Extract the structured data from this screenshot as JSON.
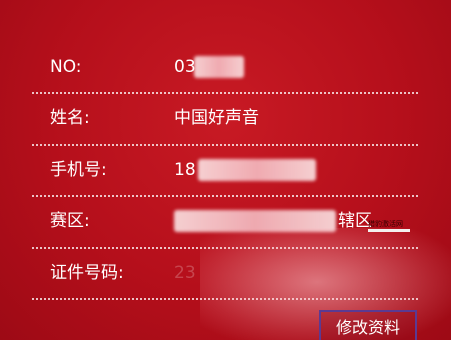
{
  "profile": {
    "fields": [
      {
        "label": "NO:",
        "value": "03"
      },
      {
        "label": "姓名:",
        "value": "中国好声音"
      },
      {
        "label": "手机号:",
        "value": "18"
      },
      {
        "label": "赛区:",
        "value": "辖区"
      },
      {
        "label": "证件号码:",
        "value": "23"
      }
    ]
  },
  "watermark": {
    "text": "猎豹激活网"
  },
  "actions": {
    "edit_label": "修改资料"
  },
  "colors": {
    "background": "#b30f1a",
    "text": "#ffffff",
    "button_border": "#5b3a92"
  }
}
